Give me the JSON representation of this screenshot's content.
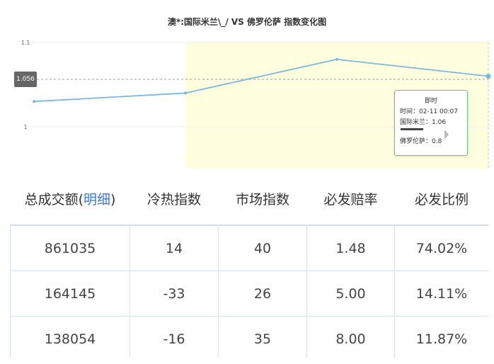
{
  "chart": {
    "title": "澳*:国际米兰\\_/ VS 佛罗伦萨 指数变化图",
    "crosshair_label": "1.056",
    "tooltip": {
      "title": "即时",
      "time": "时间：02-11 00:07",
      "home": "国际米兰：1.06",
      "away": "佛罗伦萨：0.8"
    }
  },
  "chart_data": {
    "type": "line",
    "title": "澳*:国际米兰\\_/ VS 佛罗伦萨 指数变化图",
    "y_ticks": [
      "1.1",
      "1"
    ],
    "ylim": [
      0.9,
      1.1
    ],
    "series": [
      {
        "values": [
          1.03,
          1.04,
          1.08,
          1.06
        ]
      }
    ],
    "highlight_color": "#ffffe0",
    "line_color": "#7ab8e0"
  },
  "table": {
    "headers": [
      {
        "text": "总成交额(",
        "link": "明细",
        "after": ")"
      },
      {
        "text": "冷热指数"
      },
      {
        "text": "市场指数"
      },
      {
        "text": "必发赔率"
      },
      {
        "text": "必发比例"
      }
    ],
    "rows": [
      [
        "861035",
        "14",
        "40",
        "1.48",
        "74.02%"
      ],
      [
        "164145",
        "-33",
        "26",
        "5.00",
        "14.11%"
      ],
      [
        "138054",
        "-16",
        "35",
        "8.00",
        "11.87%"
      ]
    ]
  }
}
